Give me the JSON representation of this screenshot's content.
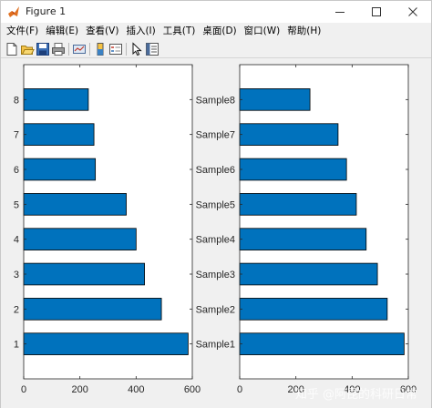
{
  "window": {
    "title": "Figure 1"
  },
  "menu": [
    {
      "label": "文件(F)",
      "name": "menu-file"
    },
    {
      "label": "编辑(E)",
      "name": "menu-edit"
    },
    {
      "label": "查看(V)",
      "name": "menu-view"
    },
    {
      "label": "插入(I)",
      "name": "menu-insert"
    },
    {
      "label": "工具(T)",
      "name": "menu-tools"
    },
    {
      "label": "桌面(D)",
      "name": "menu-desktop"
    },
    {
      "label": "窗口(W)",
      "name": "menu-window"
    },
    {
      "label": "帮助(H)",
      "name": "menu-help"
    }
  ],
  "toolbar": {
    "buttons": [
      "new-figure-icon",
      "open-file-icon",
      "save-icon",
      "print-icon",
      "link-plot-icon",
      "insert-colorbar-icon",
      "insert-legend-icon",
      "edit-plot-icon",
      "property-inspector-icon"
    ]
  },
  "watermark": "知乎 @阿昆的科研日常",
  "colors": {
    "bar_fill": "#0072bd",
    "bar_edge": "#000000",
    "axes_bg": "#ffffff",
    "figure_bg": "#f0f0f0"
  },
  "chart_data": [
    {
      "type": "bar",
      "orientation": "horizontal",
      "categories": [
        "1",
        "2",
        "3",
        "4",
        "5",
        "6",
        "7",
        "8"
      ],
      "values": [
        585,
        490,
        430,
        400,
        365,
        255,
        250,
        230
      ],
      "xlim": [
        0,
        600
      ],
      "xticks": [
        "0",
        "200",
        "400",
        "600"
      ],
      "yticks": [
        "1",
        "2",
        "3",
        "4",
        "5",
        "6",
        "7",
        "8"
      ],
      "grid": false
    },
    {
      "type": "bar",
      "orientation": "horizontal",
      "categories": [
        "Sample1",
        "Sample2",
        "Sample3",
        "Sample4",
        "Sample5",
        "Sample6",
        "Sample7",
        "Sample8"
      ],
      "values": [
        585,
        525,
        490,
        450,
        415,
        380,
        350,
        250
      ],
      "xlim": [
        0,
        600
      ],
      "xticks": [
        "0",
        "200",
        "400",
        "600"
      ],
      "yticks": [
        "Sample1",
        "Sample2",
        "Sample3",
        "Sample4",
        "Sample5",
        "Sample6",
        "Sample7",
        "Sample8"
      ],
      "grid": false
    }
  ]
}
